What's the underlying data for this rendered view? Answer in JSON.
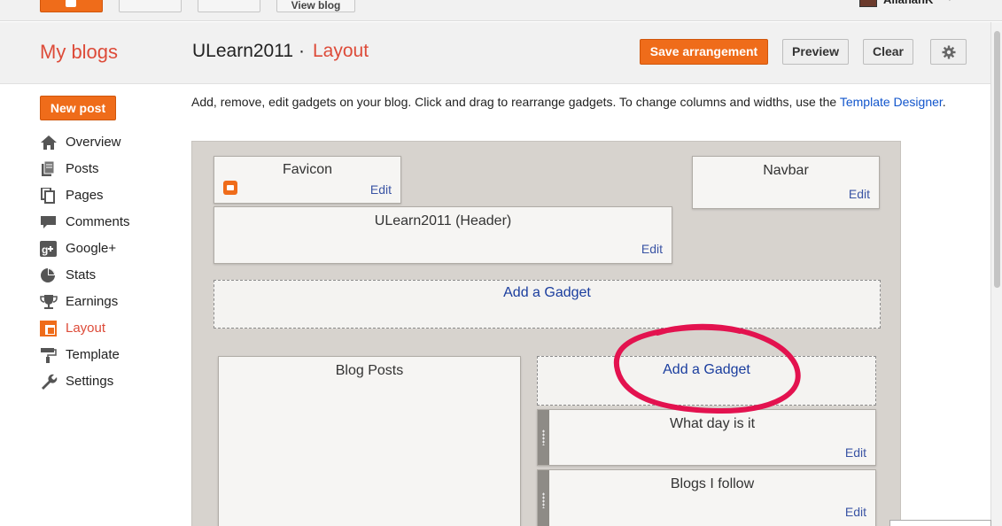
{
  "topbar": {
    "view_blog": "View blog",
    "user_name": "AllanahK"
  },
  "header": {
    "my_blogs": "My blogs",
    "blog_title": "ULearn2011",
    "separator": "·",
    "page_name": "Layout",
    "save_label": "Save arrangement",
    "preview_label": "Preview",
    "clear_label": "Clear"
  },
  "sidebar": {
    "new_post": "New post",
    "items": [
      {
        "label": "Overview",
        "icon": "home-icon",
        "active": false
      },
      {
        "label": "Posts",
        "icon": "posts-icon",
        "active": false
      },
      {
        "label": "Pages",
        "icon": "pages-icon",
        "active": false
      },
      {
        "label": "Comments",
        "icon": "comments-icon",
        "active": false
      },
      {
        "label": "Google+",
        "icon": "google-plus-icon",
        "active": false
      },
      {
        "label": "Stats",
        "icon": "stats-icon",
        "active": false
      },
      {
        "label": "Earnings",
        "icon": "trophy-icon",
        "active": false
      },
      {
        "label": "Layout",
        "icon": "layout-icon",
        "active": true
      },
      {
        "label": "Template",
        "icon": "paint-roller-icon",
        "active": false
      },
      {
        "label": "Settings",
        "icon": "wrench-icon",
        "active": false
      }
    ]
  },
  "main": {
    "instructions": "Add, remove, edit gadgets on your blog. Click and drag to rearrange gadgets. To change columns and widths, use the",
    "template_link": "Template Designer",
    "instructions_end": ".",
    "widgets": {
      "favicon": {
        "title": "Favicon",
        "edit": "Edit"
      },
      "navbar": {
        "title": "Navbar",
        "edit": "Edit"
      },
      "header": {
        "title": "ULearn2011 (Header)",
        "edit": "Edit"
      },
      "add_gadget_top": "Add a Gadget",
      "blog_posts": {
        "title": "Blog Posts"
      },
      "add_gadget_sidebar": "Add a Gadget",
      "what_day": {
        "title": "What day is it",
        "edit": "Edit"
      },
      "blogs_follow": {
        "title": "Blogs I follow",
        "edit": "Edit"
      }
    }
  },
  "colors": {
    "accent_orange": "#ef6c1a",
    "active_red": "#dd4b39",
    "link_blue": "#1a3d9e",
    "annotation_pink": "#e3124f"
  }
}
